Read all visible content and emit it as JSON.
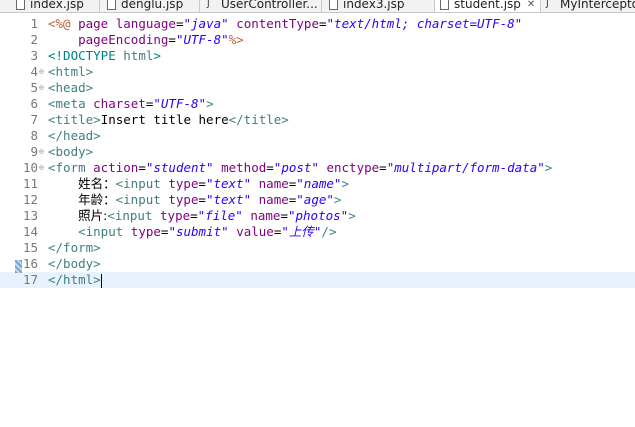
{
  "tabs": [
    {
      "label": "index.jsp",
      "icon": "jsp-file-icon"
    },
    {
      "label": "denglu.jsp",
      "icon": "jsp-file-icon"
    },
    {
      "label": "UserController...",
      "icon": "java-file-icon"
    },
    {
      "label": "index3.jsp",
      "icon": "jsp-file-icon"
    },
    {
      "label": "student.jsp",
      "icon": "jsp-file-icon",
      "active": true,
      "close": "✕"
    },
    {
      "label": "MyIntercepto",
      "icon": "java-file-icon"
    }
  ],
  "lines": [
    {
      "n": "1",
      "parts": [
        [
          "jsp",
          "<%@ "
        ],
        [
          "attr",
          "page "
        ],
        [
          "attr",
          "language"
        ],
        [
          "p",
          "="
        ],
        [
          "val",
          "\"java\""
        ],
        [
          "p",
          " "
        ],
        [
          "attr",
          "contentType"
        ],
        [
          "p",
          "="
        ],
        [
          "val",
          "\"text/html; charset=UTF-8\""
        ]
      ]
    },
    {
      "n": "2",
      "parts": [
        [
          "p",
          "    "
        ],
        [
          "attr",
          "pageEncoding"
        ],
        [
          "p",
          "="
        ],
        [
          "val",
          "\"UTF-8\""
        ],
        [
          "jsp",
          "%>"
        ]
      ]
    },
    {
      "n": "3",
      "parts": [
        [
          "doctype",
          "<!DOCTYPE "
        ],
        [
          "tag",
          "html"
        ],
        [
          "doctype",
          ">"
        ]
      ]
    },
    {
      "n": "4",
      "fold": "⊖",
      "parts": [
        [
          "tag",
          "<html>"
        ]
      ]
    },
    {
      "n": "5",
      "fold": "⊖",
      "parts": [
        [
          "tag",
          "<head>"
        ]
      ]
    },
    {
      "n": "6",
      "parts": [
        [
          "tag",
          "<meta "
        ],
        [
          "attr",
          "charset"
        ],
        [
          "p",
          "="
        ],
        [
          "val",
          "\"UTF-8\""
        ],
        [
          "tag",
          ">"
        ]
      ]
    },
    {
      "n": "7",
      "parts": [
        [
          "tag",
          "<title>"
        ],
        [
          "p",
          "Insert title here"
        ],
        [
          "tag",
          "</title>"
        ]
      ]
    },
    {
      "n": "8",
      "parts": [
        [
          "tag",
          "</head>"
        ]
      ]
    },
    {
      "n": "9",
      "fold": "⊖",
      "parts": [
        [
          "tag",
          "<body>"
        ]
      ]
    },
    {
      "n": "10",
      "fold": "⊖",
      "parts": [
        [
          "tag",
          "<form "
        ],
        [
          "attr",
          "action"
        ],
        [
          "p",
          "="
        ],
        [
          "val",
          "\"student\""
        ],
        [
          "p",
          " "
        ],
        [
          "attr",
          "method"
        ],
        [
          "p",
          "="
        ],
        [
          "val",
          "\"post\""
        ],
        [
          "p",
          " "
        ],
        [
          "attr",
          "enctype"
        ],
        [
          "p",
          "="
        ],
        [
          "val",
          "\"multipart/form-data\""
        ],
        [
          "tag",
          ">"
        ]
      ]
    },
    {
      "n": "11",
      "parts": [
        [
          "p",
          "    "
        ],
        [
          "cjk",
          "姓名："
        ],
        [
          "tag",
          "<input "
        ],
        [
          "attr",
          "type"
        ],
        [
          "p",
          "="
        ],
        [
          "val",
          "\"text\""
        ],
        [
          "p",
          " "
        ],
        [
          "attr",
          "name"
        ],
        [
          "p",
          "="
        ],
        [
          "val",
          "\"name\""
        ],
        [
          "tag",
          ">"
        ]
      ]
    },
    {
      "n": "12",
      "parts": [
        [
          "p",
          "    "
        ],
        [
          "cjk",
          "年龄："
        ],
        [
          "tag",
          "<input "
        ],
        [
          "attr",
          "type"
        ],
        [
          "p",
          "="
        ],
        [
          "val",
          "\"text\""
        ],
        [
          "p",
          " "
        ],
        [
          "attr",
          "name"
        ],
        [
          "p",
          "="
        ],
        [
          "val",
          "\"age\""
        ],
        [
          "tag",
          ">"
        ]
      ]
    },
    {
      "n": "13",
      "parts": [
        [
          "p",
          "    "
        ],
        [
          "cjk",
          "照片:"
        ],
        [
          "tag",
          "<input "
        ],
        [
          "attr",
          "type"
        ],
        [
          "p",
          "="
        ],
        [
          "val",
          "\"file\""
        ],
        [
          "p",
          " "
        ],
        [
          "attr",
          "name"
        ],
        [
          "p",
          "="
        ],
        [
          "val",
          "\"photos\""
        ],
        [
          "tag",
          ">"
        ]
      ]
    },
    {
      "n": "14",
      "parts": [
        [
          "p",
          "    "
        ],
        [
          "tag",
          "<input "
        ],
        [
          "attr",
          "type"
        ],
        [
          "p",
          "="
        ],
        [
          "val",
          "\"submit\""
        ],
        [
          "p",
          " "
        ],
        [
          "attr",
          "value"
        ],
        [
          "p",
          "="
        ],
        [
          "val",
          "\"上传\""
        ],
        [
          "tag",
          "/>"
        ]
      ]
    },
    {
      "n": "15",
      "parts": [
        [
          "tag",
          "</form>"
        ]
      ]
    },
    {
      "n": "16",
      "parts": [
        [
          "tag",
          "</body>"
        ]
      ]
    },
    {
      "n": "17",
      "current": true,
      "parts": [
        [
          "tag",
          "</html>"
        ]
      ]
    }
  ]
}
